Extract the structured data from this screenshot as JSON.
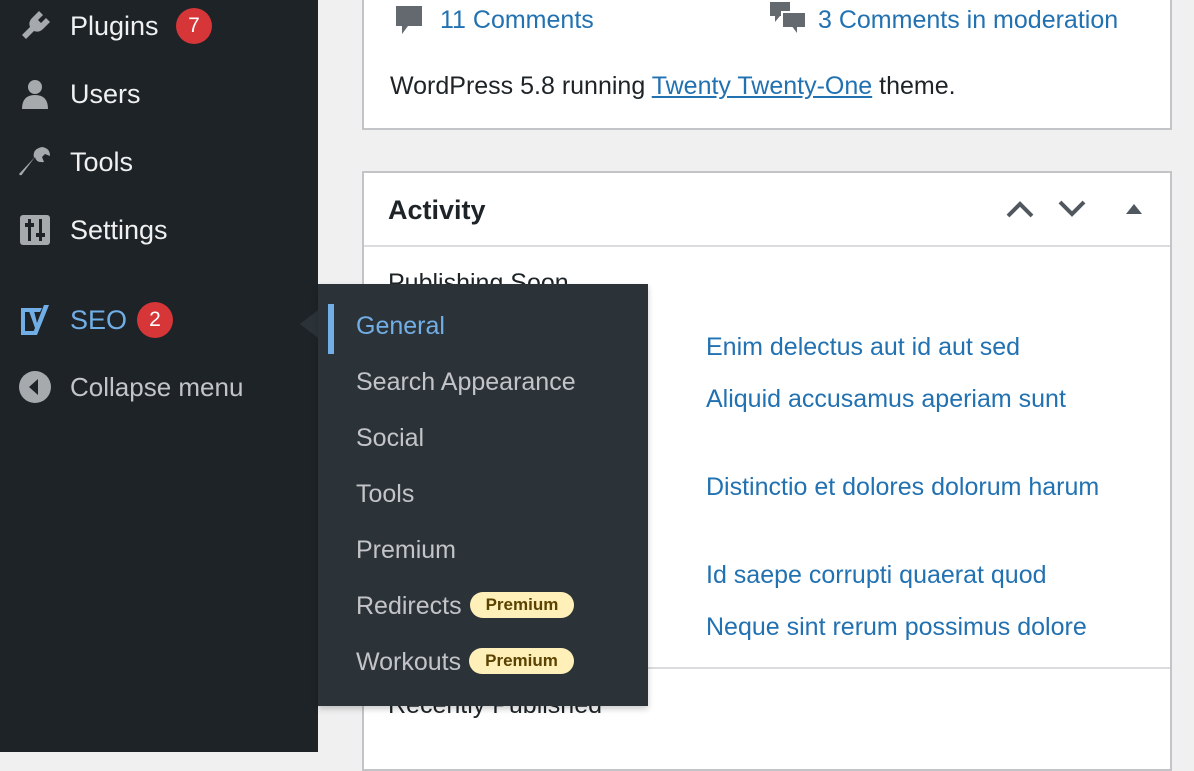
{
  "sidebar": {
    "items": [
      {
        "key": "plugins",
        "label": "Plugins",
        "badge": "7",
        "icon": "plugin-icon"
      },
      {
        "key": "users",
        "label": "Users",
        "icon": "users-icon"
      },
      {
        "key": "tools",
        "label": "Tools",
        "icon": "wrench-icon"
      },
      {
        "key": "settings",
        "label": "Settings",
        "icon": "settings-sliders-icon"
      },
      {
        "key": "seo",
        "label": "SEO",
        "badge": "2",
        "icon": "yoast-icon"
      },
      {
        "key": "collapse",
        "label": "Collapse menu",
        "icon": "collapse-arrow-icon"
      }
    ]
  },
  "seo_submenu": {
    "items": [
      {
        "label": "General",
        "active": true
      },
      {
        "label": "Search Appearance"
      },
      {
        "label": "Social"
      },
      {
        "label": "Tools"
      },
      {
        "label": "Premium"
      },
      {
        "label": "Redirects",
        "tag": "Premium"
      },
      {
        "label": "Workouts",
        "tag": "Premium"
      }
    ]
  },
  "at_a_glance": {
    "comments": "11 Comments",
    "moderation": "3 Comments in moderation",
    "version_prefix": "WordPress 5.8 running ",
    "theme_link": "Twenty Twenty-One",
    "version_suffix": " theme."
  },
  "activity": {
    "title": "Activity",
    "publishing_soon": "Publishing Soon",
    "posts": [
      "Enim delectus aut id aut sed",
      "Aliquid accusamus aperiam sunt",
      "Distinctio et dolores dolorum harum",
      "Id saepe corrupti quaerat quod",
      "Neque sint rerum possimus dolore"
    ],
    "recently_published": "Recently Published"
  },
  "colors": {
    "sidebar_bg": "#1d2327",
    "submenu_bg": "#2c3338",
    "accent": "#72aee6",
    "link": "#2271b1",
    "badge": "#d63638",
    "premium_bg": "#fef0b8"
  }
}
